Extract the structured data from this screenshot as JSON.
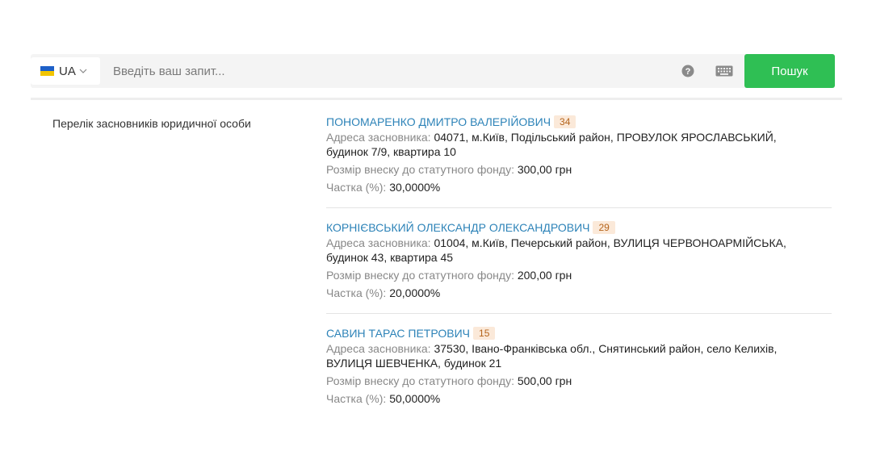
{
  "search": {
    "lang_code": "UA",
    "placeholder": "Введіть ваш запит...",
    "value": "",
    "button_label": "Пошук"
  },
  "section": {
    "label": "Перелік засновників юридичної особи"
  },
  "founders": [
    {
      "name": "ПОНОМАРЕНКО ДМИТРО ВАЛЕРІЙОВИЧ",
      "age": "34",
      "address_label": "Адреса засновника:",
      "address_line1": "04071, м.Київ, Подільський район, ПРОВУЛОК ЯРОСЛАВСЬКИЙ,",
      "address_line2": "будинок 7/9, квартира 10",
      "contribution_label": "Розмір внеску до статутного фонду:",
      "contribution_value": "300,00 грн",
      "share_label": "Частка (%):",
      "share_value": "30,0000%"
    },
    {
      "name": "КОРНІЄВСЬКИЙ ОЛЕКСАНДР ОЛЕКСАНДРОВИЧ",
      "age": "29",
      "address_label": "Адреса засновника:",
      "address_line1": "01004, м.Київ, Печерський район, ВУЛИЦЯ ЧЕРВОНОАРМІЙСЬКА,",
      "address_line2": "будинок 43, квартира 45",
      "contribution_label": "Розмір внеску до статутного фонду:",
      "contribution_value": "200,00 грн",
      "share_label": "Частка (%):",
      "share_value": "20,0000%"
    },
    {
      "name": "САВИН ТАРАС ПЕТРОВИЧ",
      "age": "15",
      "address_label": "Адреса засновника:",
      "address_line1": "37530, Івано-Франківська обл., Снятинський район, село Келихів,",
      "address_line2": "ВУЛИЦЯ ШЕВЧЕНКА, будинок 21",
      "contribution_label": "Розмір внеску до статутного фонду:",
      "contribution_value": "500,00 грн",
      "share_label": "Частка (%):",
      "share_value": "50,0000%"
    }
  ],
  "colors": {
    "accent_green": "#2fbf54",
    "link_blue": "#2d83b8",
    "badge_bg": "#fbe9d9",
    "badge_text": "#b5651d"
  },
  "icons": {
    "flag": "ukraine-flag-icon",
    "chevron": "chevron-down-icon",
    "help": "help-circle-icon",
    "keyboard": "keyboard-icon"
  }
}
